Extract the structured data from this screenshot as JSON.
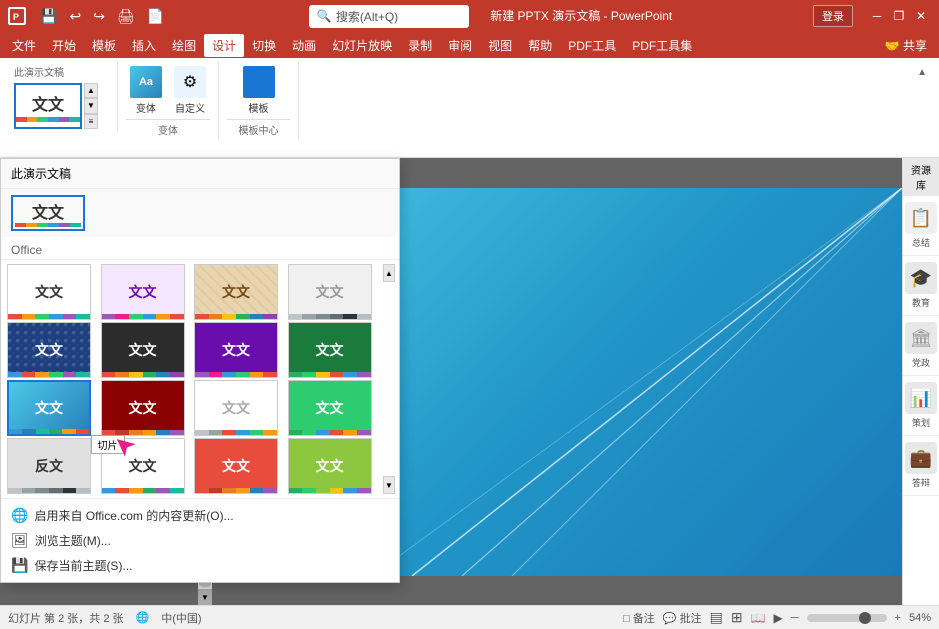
{
  "titlebar": {
    "app_icon": "P",
    "quick_save": "💾",
    "quick_undo": "↩",
    "quick_redo": "↪",
    "quick_print": "🖨",
    "quick_pdf": "📄",
    "title": "新建 PPTX 演示文稿 - PowerPoint",
    "search_placeholder": "搜索(Alt+Q)",
    "login_label": "登录",
    "min_btn": "─",
    "restore_btn": "❐",
    "close_btn": "✕"
  },
  "menubar": {
    "items": [
      "文件",
      "开始",
      "模板",
      "插入",
      "绘图",
      "设计",
      "切换",
      "动画",
      "幻灯片放映",
      "录制",
      "审阅",
      "视图",
      "帮助",
      "PDF工具",
      "PDF工具集",
      "共享"
    ],
    "active_index": 5
  },
  "ribbon": {
    "this_presentation_label": "此演示文稿",
    "variant_label": "变体",
    "customize_label": "自定义",
    "template_label": "模板",
    "template_center_label": "模板中心",
    "collapse_btn": "▲"
  },
  "theme_dropdown": {
    "section_label": "Office",
    "current_section": "此演示文稿",
    "themes": [
      {
        "label": "文文",
        "bg": "#ffffff",
        "text": "#333",
        "color_bar": [
          "#e74c3c",
          "#f39c12",
          "#2ecc71",
          "#3498db",
          "#9b59b6",
          "#1abc9c"
        ],
        "selected": false
      },
      {
        "label": "文文",
        "bg": "#f5e6ff",
        "text": "#6a0dad",
        "color_bar": [
          "#9b59b6",
          "#e91e8c",
          "#2ecc71",
          "#3498db",
          "#f39c12",
          "#e74c3c"
        ],
        "selected": false
      },
      {
        "label": "文文",
        "bg": "#f5e6cc",
        "text": "#7b4513",
        "color_bar": [
          "#e74c3c",
          "#e67e22",
          "#f1c40f",
          "#27ae60",
          "#2980b9",
          "#8e44ad"
        ],
        "selected": false
      },
      {
        "label": "文文",
        "bg": "#f0f0f0",
        "text": "#999",
        "color_bar": [
          "#bdc3c7",
          "#95a5a6",
          "#7f8c8d",
          "#636e72",
          "#2d3436",
          "#b2bec3"
        ],
        "selected": false
      },
      {
        "label": "文文",
        "bg": "#1e4080",
        "text": "#fff",
        "pattern": "dots",
        "color_bar": [
          "#3498db",
          "#e74c3c",
          "#f39c12",
          "#2ecc71",
          "#9b59b6",
          "#1abc9c"
        ],
        "selected": false
      },
      {
        "label": "文文",
        "bg": "#333",
        "text": "#fff",
        "color_bar": [
          "#e74c3c",
          "#e67e22",
          "#f1c40f",
          "#27ae60",
          "#2980b9",
          "#8e44ad"
        ],
        "selected": false
      },
      {
        "label": "文文",
        "bg": "#6a0dad",
        "text": "#fff",
        "color_bar": [
          "#9b59b6",
          "#e91e8c",
          "#3498db",
          "#2ecc71",
          "#f39c12",
          "#e74c3c"
        ],
        "selected": false
      },
      {
        "label": "文文",
        "bg": "#27ae60",
        "text": "#fff",
        "color_bar": [
          "#27ae60",
          "#2ecc71",
          "#f1c40f",
          "#e74c3c",
          "#3498db",
          "#9b59b6"
        ],
        "selected": false
      },
      {
        "label": "文文",
        "bg": "#4cc8e8",
        "text": "#fff",
        "color_bar": [
          "#3498db",
          "#2980b9",
          "#1abc9c",
          "#27ae60",
          "#f39c12",
          "#e74c3c"
        ],
        "selected": true
      },
      {
        "label": "文文",
        "bg": "#8B0000",
        "text": "#fff",
        "color_bar": [
          "#e74c3c",
          "#c0392b",
          "#e67e22",
          "#f39c12",
          "#2980b9",
          "#9b59b6"
        ],
        "selected": false
      },
      {
        "label": "文文",
        "bg": "#fff",
        "text": "#aaa",
        "border": "#ccc",
        "color_bar": [
          "#bdc3c7",
          "#95a5a6",
          "#e74c3c",
          "#3498db",
          "#2ecc71",
          "#f39c12"
        ],
        "selected": false
      },
      {
        "label": "文文",
        "bg": "#2ecc71",
        "text": "#fff",
        "color_bar": [
          "#27ae60",
          "#2ecc71",
          "#3498db",
          "#e74c3c",
          "#f39c12",
          "#9b59b6"
        ],
        "selected": false
      },
      {
        "label": "反文",
        "bg": "#e8e8e8",
        "text": "#333",
        "color_bar": [
          "#bdc3c7",
          "#95a5a6",
          "#7f8c8d",
          "#636e72",
          "#2d3436",
          "#b2bec3"
        ],
        "selected": false
      },
      {
        "label": "文文",
        "bg": "#fff",
        "text": "#333",
        "color_bar": [
          "#3498db",
          "#e74c3c",
          "#f39c12",
          "#27ae60",
          "#9b59b6",
          "#1abc9c"
        ],
        "selected": false
      },
      {
        "label": "文文",
        "bg": "#e74c3c",
        "text": "#fff",
        "color_bar": [
          "#e74c3c",
          "#c0392b",
          "#e67e22",
          "#f39c12",
          "#2980b9",
          "#9b59b6"
        ],
        "selected": false
      },
      {
        "label": "文文",
        "bg": "#8dc63f",
        "text": "#fff",
        "color_bar": [
          "#27ae60",
          "#2ecc71",
          "#8dc63f",
          "#f1c40f",
          "#3498db",
          "#9b59b6"
        ],
        "selected": false
      }
    ],
    "tooltip": "切片",
    "footer_links": [
      {
        "icon": "🌐",
        "label": "启用来自 Office.com 的内容更新(O)..."
      },
      {
        "icon": "🖼",
        "label": "浏览主题(M)..."
      },
      {
        "icon": "💾",
        "label": "保存当前主题(S)..."
      }
    ]
  },
  "status_bar": {
    "slide_info": "幻灯片 第 2 张，共 2 张",
    "lang": "中(中国)",
    "notes": "备注",
    "comments": "批注",
    "view_normal": "▤",
    "view_slide_sorter": "⊞",
    "view_reading": "📖",
    "view_slideshow": "▶",
    "zoom_level": "54%",
    "zoom_minus": "─",
    "zoom_plus": "+"
  },
  "right_panel": {
    "title": "资源库",
    "items": [
      {
        "icon": "📋",
        "label": "总结"
      },
      {
        "icon": "🎓",
        "label": "教育"
      },
      {
        "icon": "🏛",
        "label": "党政"
      },
      {
        "icon": "📊",
        "label": "策划"
      },
      {
        "icon": "💼",
        "label": "答辩"
      }
    ]
  }
}
